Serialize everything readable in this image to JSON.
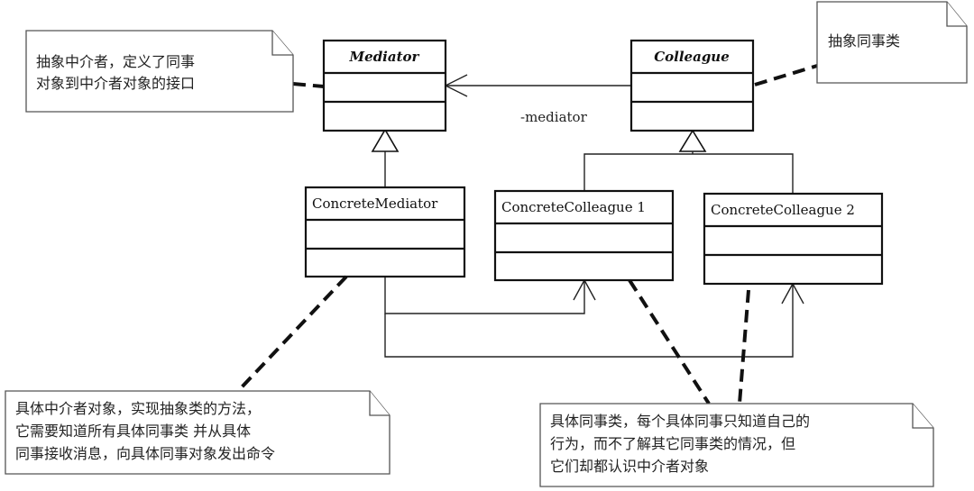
{
  "diagram": {
    "type": "UML class diagram",
    "pattern": "Mediator"
  },
  "classes": {
    "mediator": {
      "name": "Mediator",
      "abstract": true
    },
    "colleague": {
      "name": "Colleague",
      "abstract": true
    },
    "concrete_mediator": {
      "name": "ConcreteMediator",
      "abstract": false
    },
    "concrete_colleague_1": {
      "name": "ConcreteColleague 1",
      "abstract": false
    },
    "concrete_colleague_2": {
      "name": "ConcreteColleague 2",
      "abstract": false
    }
  },
  "associations": {
    "colleague_to_mediator_role": "-mediator"
  },
  "notes": {
    "abstract_mediator": {
      "lines": [
        "抽象中介者，定义了同事",
        "对象到中介者对象的接口"
      ]
    },
    "abstract_colleague": {
      "lines": [
        "抽象同事类"
      ]
    },
    "concrete_mediator": {
      "lines": [
        "具体中介者对象，实现抽象类的方法，",
        "它需要知道所有具体同事类  并从具体",
        "同事接收消息，向具体同事对象发出命令"
      ]
    },
    "concrete_colleague": {
      "lines": [
        "具体同事类，每个具体同事只知道自己的",
        "行为，而不了解其它同事类的情况，但",
        "它们却都认识中介者对象"
      ]
    }
  }
}
